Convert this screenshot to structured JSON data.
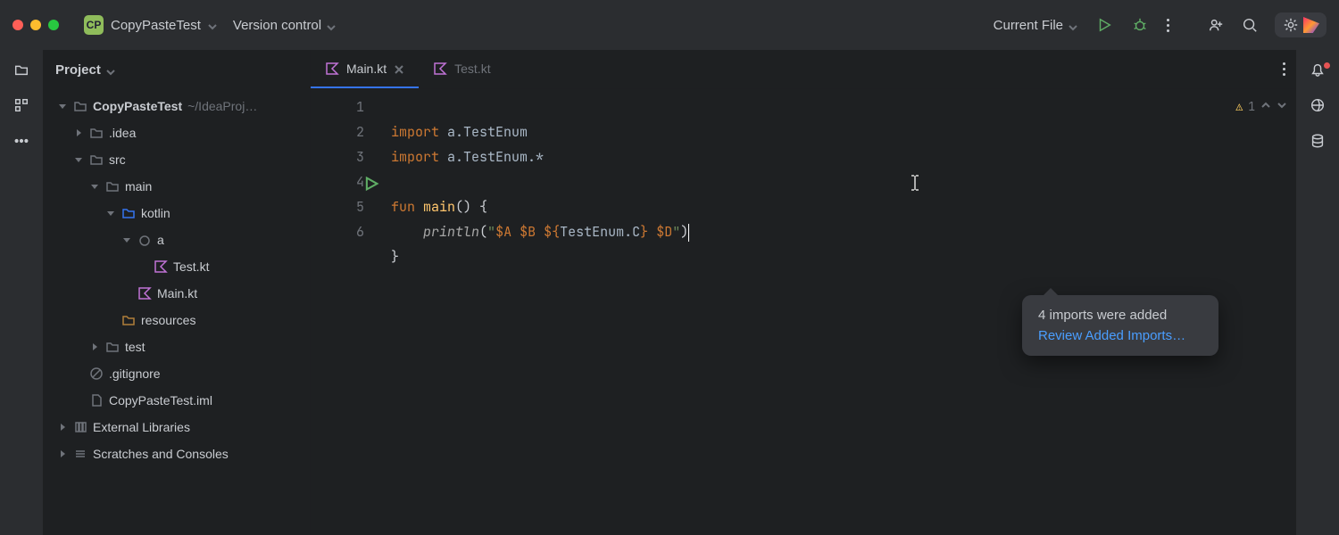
{
  "titlebar": {
    "project_initials": "CP",
    "project_name": "CopyPasteTest",
    "version_control": "Version control",
    "run_config": "Current File"
  },
  "sidebar": {
    "header": "Project",
    "tree": [
      {
        "depth": 0,
        "arrow": "down",
        "icon": "folder",
        "label": "CopyPasteTest",
        "bold": true,
        "path": "~/IdeaProj…"
      },
      {
        "depth": 1,
        "arrow": "right",
        "icon": "folder",
        "label": ".idea"
      },
      {
        "depth": 1,
        "arrow": "down",
        "icon": "folder",
        "label": "src"
      },
      {
        "depth": 2,
        "arrow": "down",
        "icon": "folder",
        "label": "main"
      },
      {
        "depth": 3,
        "arrow": "down",
        "icon": "folder-src",
        "label": "kotlin"
      },
      {
        "depth": 4,
        "arrow": "down",
        "icon": "folder-pkg",
        "label": "a"
      },
      {
        "depth": 5,
        "arrow": "",
        "icon": "kt",
        "label": "Test.kt"
      },
      {
        "depth": 4,
        "arrow": "",
        "icon": "kt",
        "label": "Main.kt"
      },
      {
        "depth": 3,
        "arrow": "",
        "icon": "folder-res",
        "label": "resources"
      },
      {
        "depth": 2,
        "arrow": "right",
        "icon": "folder",
        "label": "test"
      },
      {
        "depth": 1,
        "arrow": "",
        "icon": "ignore",
        "label": ".gitignore"
      },
      {
        "depth": 1,
        "arrow": "",
        "icon": "file",
        "label": "CopyPasteTest.iml"
      },
      {
        "depth": 0,
        "arrow": "right",
        "icon": "lib",
        "label": "External Libraries"
      },
      {
        "depth": 0,
        "arrow": "right",
        "icon": "scratch",
        "label": "Scratches and Consoles"
      }
    ]
  },
  "tabs": [
    {
      "label": "Main.kt",
      "active": true,
      "closable": true
    },
    {
      "label": "Test.kt",
      "active": false,
      "closable": false
    }
  ],
  "editor": {
    "lines": [
      "1",
      "2",
      "3",
      "4",
      "5",
      "6"
    ],
    "run_line": 4,
    "code": {
      "import1_pkg": "a.TestEnum",
      "import2_pkg": "a.TestEnum.*",
      "fun_kw": "fun",
      "main_name": "main",
      "println": "println",
      "str_open": "\"",
      "t_a": "$A",
      "t_b": "$B",
      "t_open": "${",
      "t_enum": "TestEnum",
      "t_c": ".C",
      "t_close": "}",
      "t_d": "$D",
      "str_close": "\""
    },
    "inspection_count": "1"
  },
  "tooltip": {
    "message": "4 imports were added",
    "link": "Review Added Imports…"
  }
}
